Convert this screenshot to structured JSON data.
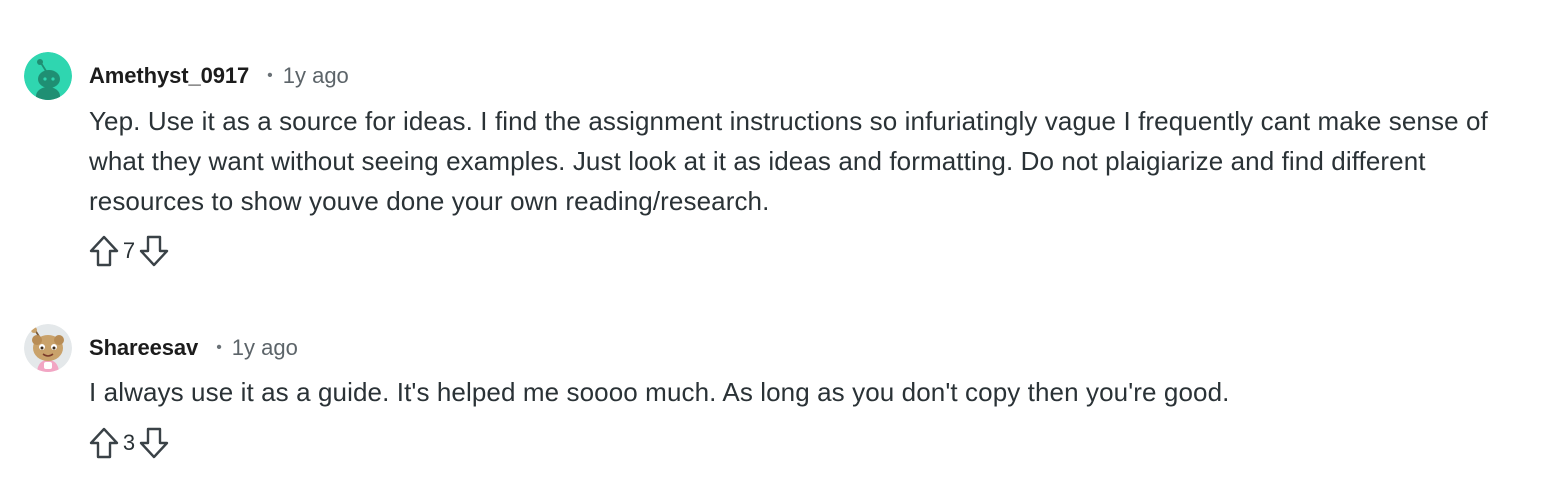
{
  "comments": [
    {
      "username": "Amethyst_0917",
      "separator": "•",
      "time": "1y ago",
      "text": "Yep. Use it as a source for ideas. I find the assignment instructions so infuriatingly vague I frequently cant make sense of what they want without seeing examples. Just look at it as ideas and formatting. Do not plaigiarize and find different resources to show youve done your own reading/research.",
      "votes": "7",
      "avatar_color": "#2fd6b0"
    },
    {
      "username": "Shareesav",
      "separator": "•",
      "time": "1y ago",
      "text": "I always use it as a guide. It's helped me soooo much. As long as you don't copy then you're good.",
      "votes": "3",
      "avatar_color": "#c9a26b"
    }
  ],
  "icons": {
    "upvote": "upvote-arrow-icon",
    "downvote": "downvote-arrow-icon"
  },
  "colors": {
    "text": "#2a3236",
    "username": "#1c1c1c",
    "meta": "#5c6469",
    "icon_stroke": "#3a4247"
  }
}
